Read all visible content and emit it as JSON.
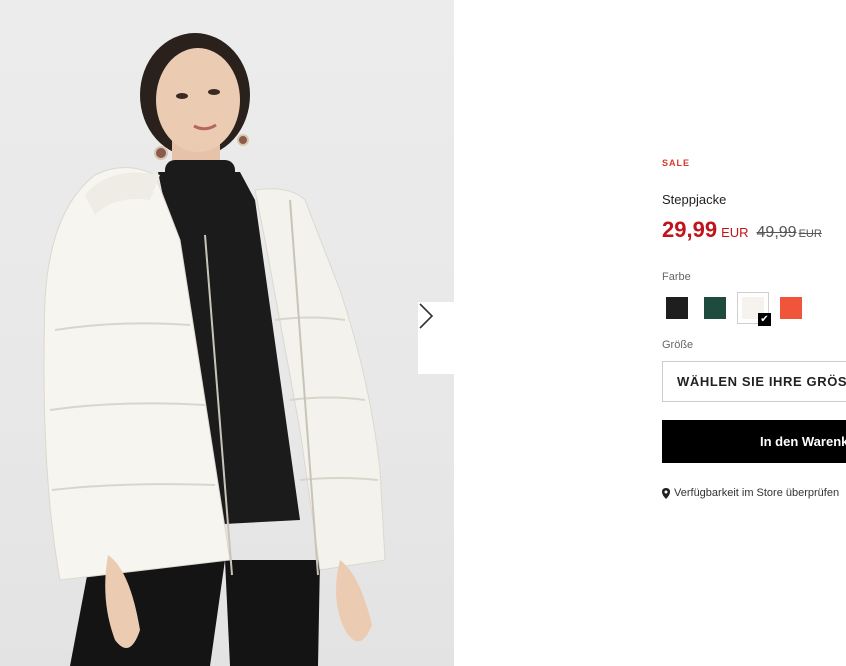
{
  "product": {
    "badge": "SALE",
    "title": "Steppjacke",
    "price_current": "29,99",
    "currency": "EUR",
    "price_old": "49,99",
    "color_label": "Farbe",
    "size_label": "Größe",
    "size_placeholder": "WÄHLEN SIE IHRE GRÖSSE",
    "add_to_cart": "In den Warenkorb",
    "store_availability": "Verfügbarkeit im Store überprüfen"
  },
  "colors": [
    {
      "name": "black",
      "hex": "#1e1e1e",
      "selected": false
    },
    {
      "name": "dark-green",
      "hex": "#1f4a3e",
      "selected": false
    },
    {
      "name": "cream",
      "hex": "#f6f3ee",
      "selected": true
    },
    {
      "name": "orange-red",
      "hex": "#f0543a",
      "selected": false
    }
  ],
  "theme": {
    "sale_color": "#d63a2b",
    "price_color": "#c0131a",
    "button_bg": "#000000"
  },
  "icons": {
    "next": "chevron-right-icon",
    "cart": "shopping-bag-icon",
    "location": "map-pin-icon",
    "check": "check-icon"
  }
}
